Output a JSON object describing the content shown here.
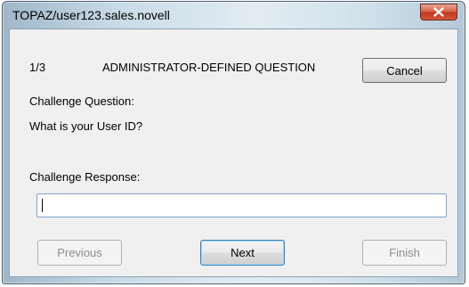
{
  "window": {
    "title": "TOPAZ/user123.sales.novell"
  },
  "header": {
    "progress": "1/3",
    "question_type": "ADMINISTRATOR-DEFINED QUESTION",
    "cancel_label": "Cancel"
  },
  "challenge": {
    "question_label": "Challenge Question:",
    "question_text": "What is your User ID?",
    "response_label": "Challenge Response:",
    "response_value": ""
  },
  "footer": {
    "previous_label": "Previous",
    "next_label": "Next",
    "finish_label": "Finish"
  },
  "icons": {
    "close": "close-icon"
  },
  "colors": {
    "close_button": "#c2361a",
    "default_button_border": "#3c7fb1",
    "input_border": "#7da2ce"
  }
}
